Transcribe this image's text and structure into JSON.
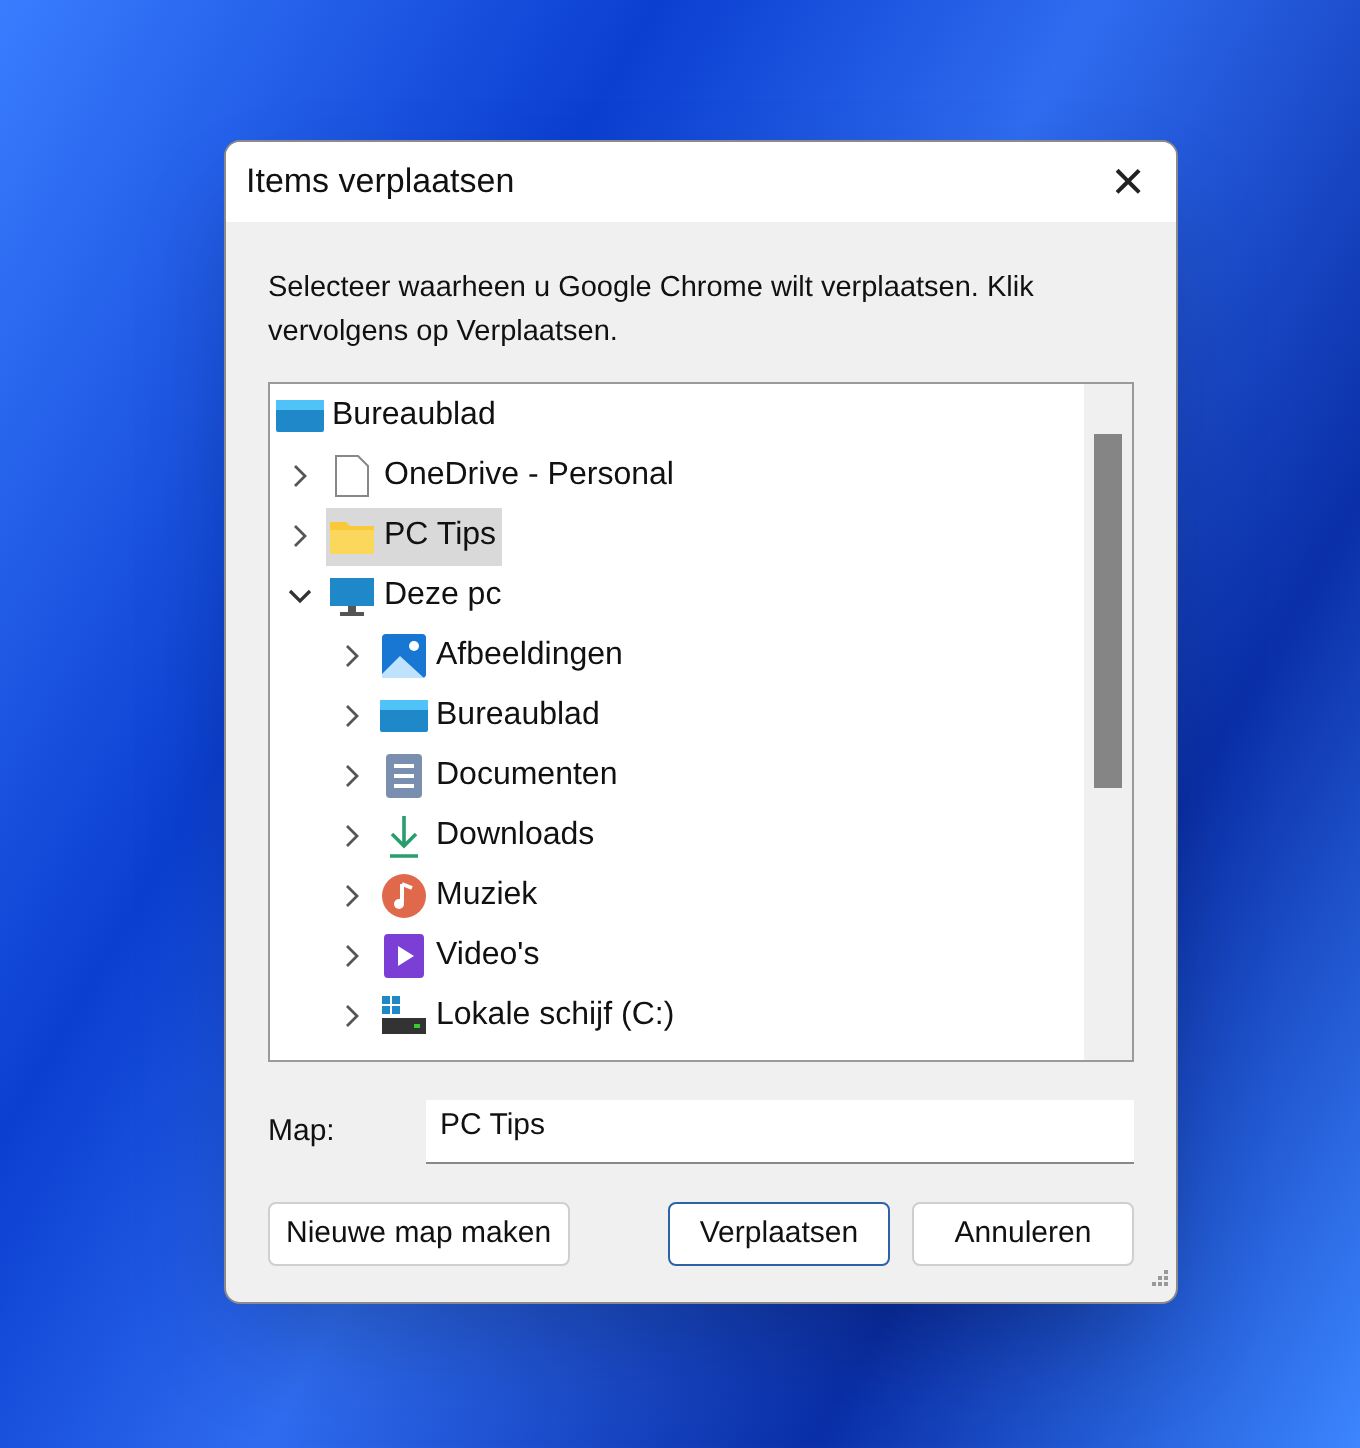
{
  "window": {
    "title": "Items verplaatsen",
    "close": "×"
  },
  "instruction": "Selecteer waarheen u Google Chrome wilt verplaatsen. Klik vervolgens op Verplaatsen.",
  "tree": [
    {
      "label": "Bureaublad",
      "kind": "desktop",
      "selected": false,
      "children": [
        {
          "label": "OneDrive - Personal",
          "kind": "file",
          "expanded": false,
          "selected": false
        },
        {
          "label": "PC Tips",
          "kind": "folder",
          "expanded": false,
          "selected": true
        },
        {
          "label": "Deze pc",
          "kind": "pc",
          "expanded": true,
          "selected": false,
          "children": [
            {
              "label": "Afbeeldingen",
              "kind": "pictures",
              "expanded": false,
              "selected": false
            },
            {
              "label": "Bureaublad",
              "kind": "desktop",
              "expanded": false,
              "selected": false
            },
            {
              "label": "Documenten",
              "kind": "documents",
              "expanded": false,
              "selected": false
            },
            {
              "label": "Downloads",
              "kind": "downloads",
              "expanded": false,
              "selected": false
            },
            {
              "label": "Muziek",
              "kind": "music",
              "expanded": false,
              "selected": false
            },
            {
              "label": "Video's",
              "kind": "videos",
              "expanded": false,
              "selected": false
            },
            {
              "label": "Lokale schijf (C:)",
              "kind": "drive",
              "expanded": false,
              "selected": false
            }
          ]
        }
      ]
    }
  ],
  "folder_field": {
    "label": "Map:",
    "value": "PC Tips"
  },
  "buttons": [
    {
      "label": "Nieuwe map maken",
      "default": false
    },
    {
      "label": "Verplaatsen",
      "default": true
    },
    {
      "label": "Annuleren",
      "default": false
    }
  ]
}
